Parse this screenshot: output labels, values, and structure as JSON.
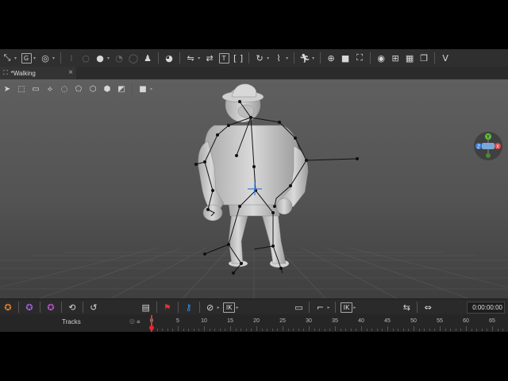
{
  "document": {
    "tab_title": "*Walking"
  },
  "icons": {
    "main_toolbar": [
      "move-tool-icon",
      "group-icon",
      "lasso-select-icon",
      "frame-icon",
      "dot-icon",
      "dot-icon",
      "sphere-icon",
      "character-icon",
      "paint-icon",
      "bone-chain-icon",
      "retarget-icon",
      "text-icon",
      "brackets-icon",
      "rotate-icon",
      "path-icon",
      "run-icon",
      "target-icon",
      "camera-icon",
      "frame-view-icon",
      "spiral-icon",
      "layout-icon",
      "checker-icon",
      "stack-icon",
      "logo-icon"
    ],
    "viewport_tools": [
      "select-arrow-icon",
      "box-select-icon",
      "rect-select-icon",
      "bone-select-icon",
      "lasso-icon",
      "polygon-icon",
      "cube-icon",
      "cube-solid-icon",
      "shading-icon",
      "camera-icon"
    ],
    "status_left": [
      "orange-rig-icon",
      "purple-rig-icon",
      "violet-rig-icon",
      "loop-icon",
      "refresh-icon"
    ],
    "status_mid": [
      "film-icon",
      "flag-icon",
      "key-icon",
      "no-icon",
      "ik-icon",
      "screen-icon",
      "step-icon",
      "ik-icon"
    ],
    "status_right": [
      "sync-icon",
      "swap-icon",
      "pin-icon",
      "marker-icon"
    ]
  },
  "statusbar": {
    "ik_label_1": "IK",
    "ik_label_2": "IK",
    "time": "0:00:00:00"
  },
  "viewport": {
    "gizmo": {
      "y_label": "Y",
      "z_label": "Z",
      "x_label": "X",
      "y_color": "#5fbf3f",
      "z_color": "#3b7fe0",
      "x_color": "#e04444"
    },
    "toolbar_labels": {
      "group": "G"
    }
  },
  "timeline": {
    "tracks_label": "Tracks",
    "ticks": [
      "0",
      "5",
      "10",
      "15",
      "20",
      "25",
      "30",
      "35",
      "40",
      "45",
      "50",
      "55",
      "60",
      "65"
    ],
    "playhead_frame": 0
  }
}
